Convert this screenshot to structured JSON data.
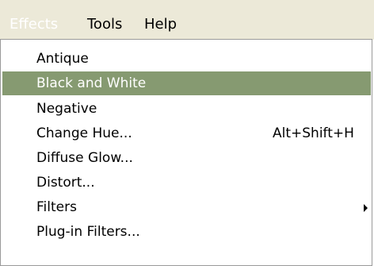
{
  "menubar": {
    "items": [
      {
        "label": "Effects",
        "active": true
      },
      {
        "label": "Tools",
        "active": false
      },
      {
        "label": "Help",
        "active": false
      }
    ]
  },
  "menu": {
    "items": [
      {
        "label": "Antique",
        "shortcut": "",
        "submenu": false,
        "highlighted": false
      },
      {
        "label": "Black and White",
        "shortcut": "",
        "submenu": false,
        "highlighted": true
      },
      {
        "label": "Negative",
        "shortcut": "",
        "submenu": false,
        "highlighted": false
      },
      {
        "label": "Change Hue...",
        "shortcut": "Alt+Shift+H",
        "submenu": false,
        "highlighted": false
      },
      {
        "label": "Diffuse Glow...",
        "shortcut": "",
        "submenu": false,
        "highlighted": false
      },
      {
        "label": "Distort...",
        "shortcut": "",
        "submenu": false,
        "highlighted": false
      },
      {
        "label": "Filters",
        "shortcut": "",
        "submenu": true,
        "highlighted": false
      },
      {
        "label": "Plug-in Filters...",
        "shortcut": "",
        "submenu": false,
        "highlighted": false
      }
    ]
  },
  "colors": {
    "highlight": "#869a71",
    "menubar_bg": "#ece9d8",
    "menu_bg": "#ffffff",
    "border": "#9a9a9a"
  }
}
